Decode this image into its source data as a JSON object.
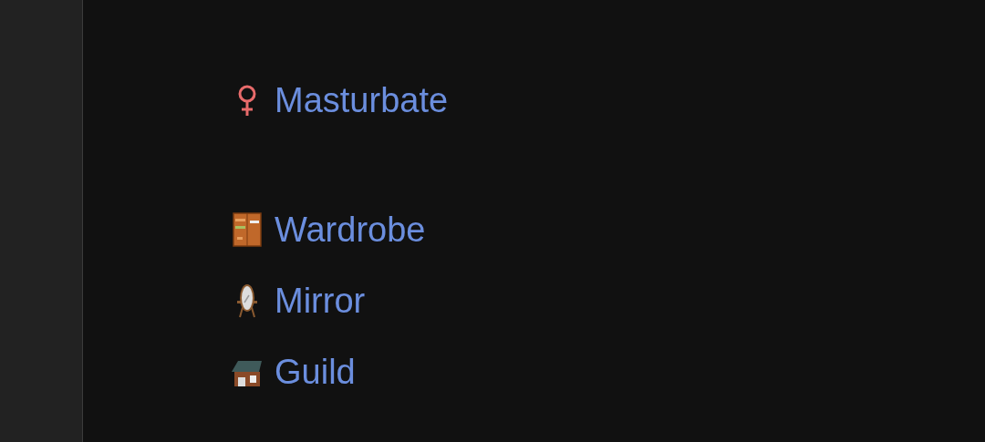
{
  "groups": [
    {
      "links": [
        {
          "label": "Masturbate",
          "kind": "female"
        }
      ]
    },
    {
      "links": [
        {
          "label": "Wardrobe",
          "kind": "wardrobe"
        },
        {
          "label": "Mirror",
          "kind": "mirror"
        },
        {
          "label": "Guild",
          "kind": "guild"
        }
      ]
    }
  ]
}
